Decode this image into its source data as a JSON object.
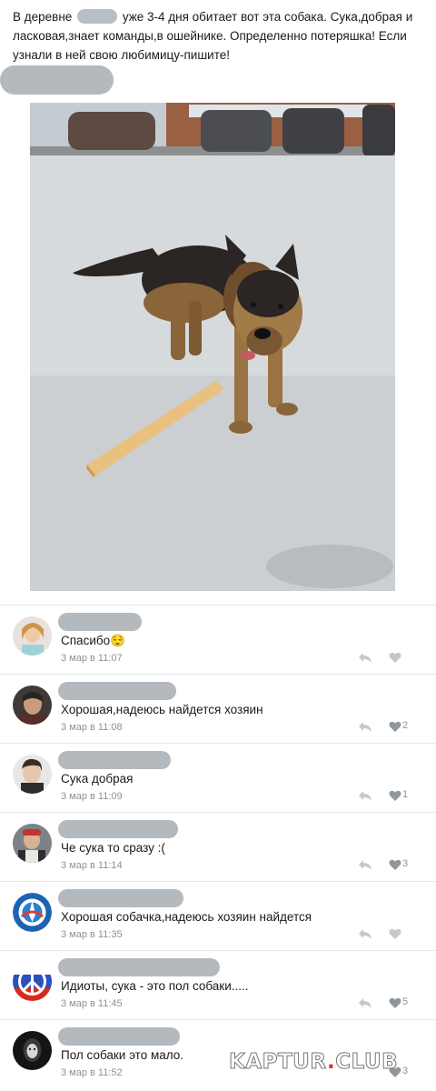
{
  "post": {
    "text_part1": "В деревне",
    "text_part2": "уже 3-4 дня обитает вот эта собака. Сука,добрая и ласковая,знает команды,в ошейнике. Определенно потеряшка! Если узнали в ней свою любимицу-пишите!"
  },
  "comments": [
    {
      "text": "Спасибо😌",
      "time": "3 мар в 11:07",
      "likes": ""
    },
    {
      "text": "Хорошая,надеюсь найдется хозяин",
      "time": "3 мар в 11:08",
      "likes": "2"
    },
    {
      "text": "Сука добрая",
      "time": "3 мар в 11:09",
      "likes": "1"
    },
    {
      "text": "Че сука то сразу :(",
      "time": "3 мар в 11:14",
      "likes": "3"
    },
    {
      "text": "Хорошая собачка,надеюсь хозяин найдется",
      "time": "3 мар в 11:35",
      "likes": ""
    },
    {
      "text": "Идиоты, сука - это пол собаки.....",
      "time": "3 мар в 11:45",
      "likes": "5"
    },
    {
      "text": "Пол собаки это мало.",
      "time": "3 мар в 11:52",
      "likes": "3"
    }
  ],
  "watermark": {
    "part1": "KAPTUR",
    "dot": ".",
    "part2": "CLUB"
  },
  "icons": {
    "reply": "reply-icon",
    "like": "heart-icon"
  },
  "colors": {
    "meta_gray": "#8a9299",
    "divider": "#e6e8ea",
    "watermark_dot": "#e0322b"
  }
}
